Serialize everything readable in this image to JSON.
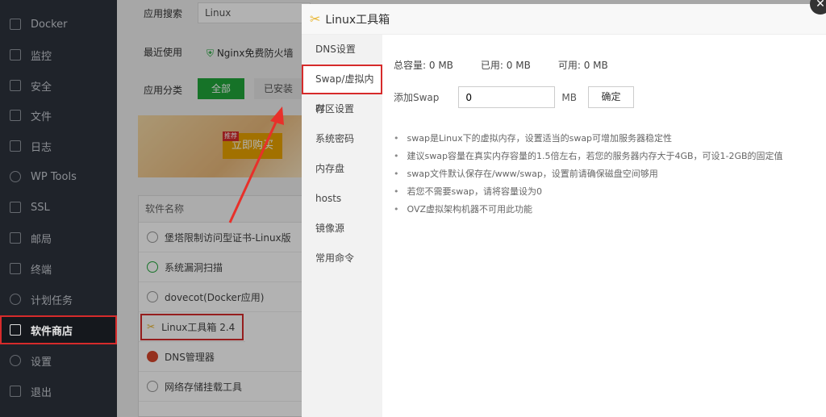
{
  "sidebar": {
    "items": [
      {
        "label": "Docker"
      },
      {
        "label": "监控"
      },
      {
        "label": "安全"
      },
      {
        "label": "文件"
      },
      {
        "label": "日志"
      },
      {
        "label": "WP Tools"
      },
      {
        "label": "SSL"
      },
      {
        "label": "邮局"
      },
      {
        "label": "终端"
      },
      {
        "label": "计划任务"
      },
      {
        "label": "软件商店"
      },
      {
        "label": "设置"
      },
      {
        "label": "退出"
      }
    ],
    "active": "软件商店"
  },
  "store": {
    "search_label": "应用搜索",
    "search_value": "Linux",
    "recent_label": "最近使用",
    "recent_app": "Nginx免费防火墙",
    "category_label": "应用分类",
    "cat_all": "全部",
    "cat_installed": "已安装",
    "banner_badge": "推荐",
    "banner_button": "立即购买",
    "table_header": "软件名称",
    "rows": [
      {
        "name": "堡塔限制访问型证书-Linux版"
      },
      {
        "name": "系统漏洞扫描"
      },
      {
        "name": "dovecot(Docker应用)"
      },
      {
        "name": "Linux工具箱 2.4"
      },
      {
        "name": "DNS管理器"
      },
      {
        "name": "网络存储挂载工具"
      }
    ]
  },
  "modal": {
    "title": "Linux工具箱",
    "nav": [
      {
        "label": "DNS设置"
      },
      {
        "label": "Swap/虚拟内存"
      },
      {
        "label": "时区设置"
      },
      {
        "label": "系统密码"
      },
      {
        "label": "内存盘"
      },
      {
        "label": "hosts"
      },
      {
        "label": "镜像源"
      },
      {
        "label": "常用命令"
      }
    ],
    "total_label": "总容量:",
    "total": "0 MB",
    "used_label": "已用:",
    "used": "0 MB",
    "avail_label": "可用:",
    "avail": "0 MB",
    "add_label": "添加Swap",
    "add_value": "0",
    "unit": "MB",
    "confirm": "确定",
    "tips": [
      "swap是Linux下的虚拟内存，设置适当的swap可增加服务器稳定性",
      "建议swap容量在真实内存容量的1.5倍左右，若您的服务器内存大于4GB，可设1-2GB的固定值",
      "swap文件默认保存在/www/swap，设置前请确保磁盘空间够用",
      "若您不需要swap，请将容量设为0",
      "OVZ虚拟架构机器不可用此功能"
    ],
    "close": "✕"
  }
}
